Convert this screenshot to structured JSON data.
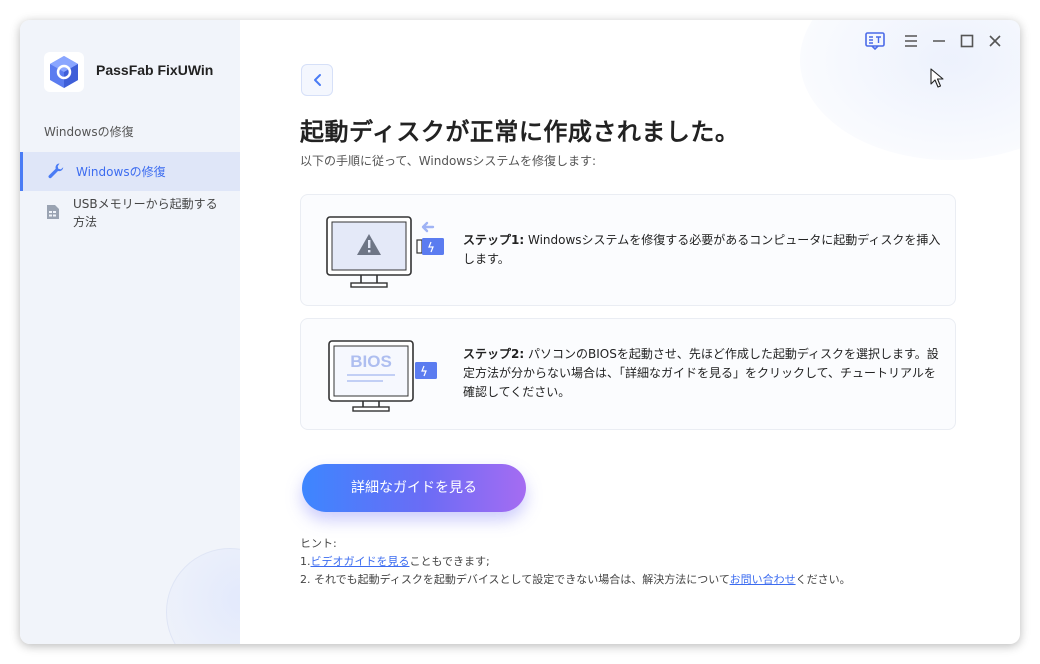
{
  "app": {
    "name": "PassFab FixUWin"
  },
  "sidebar": {
    "section_label": "Windowsの修復",
    "items": [
      {
        "label": "Windowsの修復",
        "icon": "wrench-icon",
        "active": true
      },
      {
        "label": "USBメモリーから起動する方法",
        "icon": "document-icon",
        "active": false
      }
    ]
  },
  "main": {
    "title": "起動ディスクが正常に作成されました。",
    "subtitle": "以下の手順に従って、Windowsシステムを修復します:",
    "steps": [
      {
        "heading": "ステップ1:",
        "text": "Windowsシステムを修復する必要があるコンピュータに起動ディスクを挿入します。"
      },
      {
        "heading": "ステップ2:",
        "text": "パソコンのBIOSを起動させ、先ほど作成した起動ディスクを選択します。設定方法が分からない場合は、「詳細なガイドを見る」をクリックして、チュートリアルを確認してください。"
      }
    ],
    "bios_label": "BIOS",
    "guide_button": "詳細なガイドを見る",
    "hint": {
      "label": "ヒント:",
      "line1_prefix": "1.",
      "line1_link": "ビデオガイドを見る",
      "line1_suffix": "こともできます;",
      "line2_prefix": "2. それでも起動ディスクを起動デバイスとして設定できない場合は、解決方法について",
      "line2_link": "お問い合わせ",
      "line2_suffix": "ください。"
    }
  },
  "colors": {
    "accent": "#3c6cf0",
    "sidebar_bg": "#f1f4fa",
    "active_bg": "#dfe6f8",
    "usb": "#5b7cf0"
  }
}
